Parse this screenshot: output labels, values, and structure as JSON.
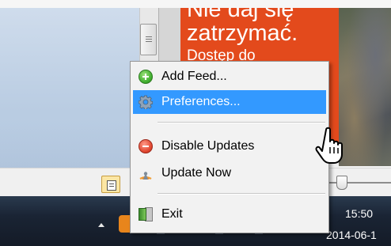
{
  "app_window": {
    "ad_text": [
      "Nie daj się",
      "zatrzymać.",
      "Dostęp do"
    ]
  },
  "context_menu": {
    "items": [
      {
        "label": "Add Feed...",
        "icon": "add-green-icon",
        "selected": false
      },
      {
        "label": "Preferences...",
        "icon": "gear-icon",
        "selected": true
      },
      {
        "label": "Disable Updates",
        "icon": "disable-red-icon",
        "selected": false
      },
      {
        "label": "Update Now",
        "icon": "rss-feed-icon",
        "selected": false
      },
      {
        "label": "Exit",
        "icon": "exit-door-icon",
        "selected": false
      }
    ]
  },
  "taskbar": {
    "clock_time": "15:50",
    "clock_date": "2014-06-1"
  },
  "colors": {
    "menu_highlight": "#3399ff",
    "ad_background": "#e34a1c",
    "taskbar": "#1a2434"
  }
}
